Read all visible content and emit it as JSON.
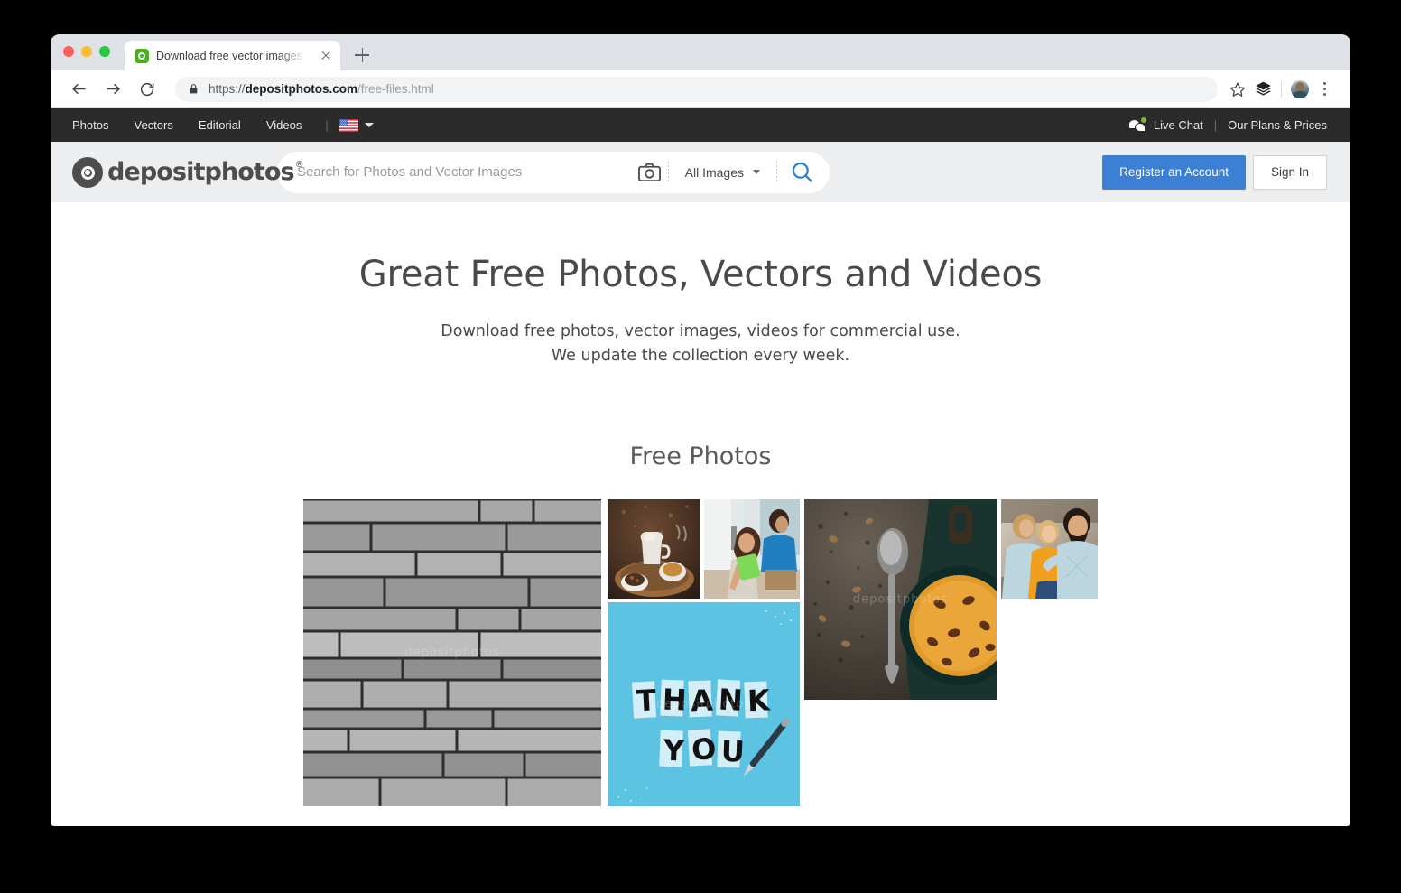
{
  "browser": {
    "tab": {
      "title": "Download free vector images a",
      "favicon": "depositphotos-camera-favicon",
      "close_icon": "close-icon",
      "new_tab_icon": "plus-icon"
    },
    "toolbar": {
      "back_icon": "back-arrow-icon",
      "forward_icon": "forward-arrow-icon",
      "reload_icon": "reload-icon",
      "lock_icon": "lock-icon",
      "url_scheme": "https://",
      "url_domain": "depositphotos.com",
      "url_path": "/free-files.html",
      "bookmark_icon": "star-icon",
      "extensions_icon": "layers-icon",
      "profile_icon": "avatar-icon",
      "menu_icon": "kebab-menu-icon"
    }
  },
  "topnav": {
    "links": [
      {
        "label": "Photos"
      },
      {
        "label": "Vectors"
      },
      {
        "label": "Editorial"
      },
      {
        "label": "Videos"
      }
    ],
    "separator": "|",
    "language": {
      "flag": "us-flag-icon",
      "caret": "chevron-down-icon"
    },
    "live_chat": {
      "label": "Live Chat",
      "icon": "chat-bubble-icon",
      "status_dot_color": "#7CB342"
    },
    "right_separator": "|",
    "plans": {
      "label": "Our Plans & Prices"
    }
  },
  "header": {
    "logo": {
      "text": "depositphotos",
      "trademark": "®",
      "icon": "camera-logo-icon"
    },
    "search": {
      "placeholder": "Search for Photos and Vector Images",
      "value": "",
      "camera_icon": "camera-search-icon",
      "filter_label": "All Images",
      "filter_caret": "chevron-down-icon",
      "submit_icon": "search-icon",
      "submit_color": "#2D7FD3"
    },
    "register_button": {
      "label": "Register an Account",
      "color": "#3B80D4"
    },
    "signin_button": {
      "label": "Sign In"
    }
  },
  "hero": {
    "title": "Great Free Photos, Vectors and Videos",
    "subtitle_line1": "Download free photos, vector images, videos for commercial use.",
    "subtitle_line2": "We update the collection every week."
  },
  "section": {
    "free_photos_title": "Free Photos"
  },
  "gallery": {
    "watermark": "depositphotos",
    "items": [
      {
        "name": "photo-stone-wall",
        "alt": "Grayscale stacked stone brick wall texture"
      },
      {
        "name": "photo-coffee-tray",
        "alt": "Coffee cup, creamer jug and pastry on a wooden tray"
      },
      {
        "name": "photo-kids-reading",
        "alt": "Girl holding a green card with boy in blue sweater"
      },
      {
        "name": "photo-thank-you",
        "alt": "THANK YOU paper letter tiles and a pen on blue background"
      },
      {
        "name": "photo-pumpkin-soup",
        "alt": "Pumpkin soup in a dark bowl with a vintage spoon, top view"
      },
      {
        "name": "photo-family",
        "alt": "Bearded father with a woman and child outdoors"
      }
    ],
    "thank_you_text": {
      "line1": "THANK",
      "line2": "YOU"
    }
  }
}
